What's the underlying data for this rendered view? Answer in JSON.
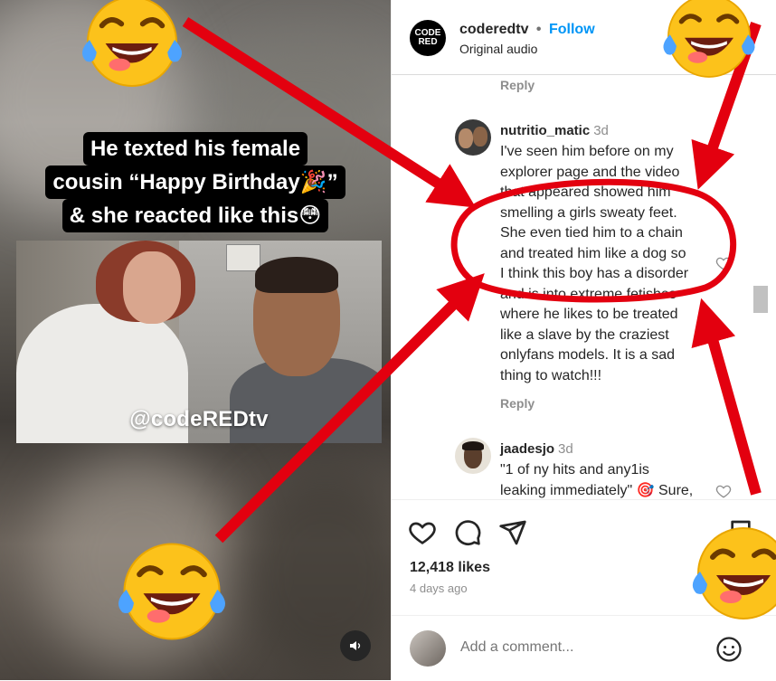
{
  "video": {
    "caption_lines": [
      "He texted his female",
      "cousin “Happy Birthday🎉”",
      "& she reacted like this😳"
    ],
    "watermark": "@codeREDtv",
    "mute_icon": "speaker-icon"
  },
  "post": {
    "logo_top": "CODE",
    "logo_bottom": "RED",
    "username": "coderedtv",
    "separator": "•",
    "follow_label": "Follow",
    "audio_label": "Original audio"
  },
  "comments": {
    "reply_label": "Reply",
    "items": [
      {
        "username": "nutritio_matic",
        "time": "3d",
        "lines": [
          "I've seen him before on my",
          "explorer page and the video",
          "that appeared showed him",
          "smelling a girls sweaty feet.",
          "She even tied him to a chain",
          "and treated him like a dog so",
          "I think this boy has a disorder",
          "and is into extreme fetishes",
          "where he likes to be treated",
          "like a slave by the craziest",
          "onlyfans models. It is a sad",
          "thing to watch!!!"
        ]
      },
      {
        "username": "jaadesjo",
        "time": "3d",
        "lines": [
          "\"1 of ny hits and any1is",
          "leaking immediately\" 🎯 Sure,"
        ]
      }
    ]
  },
  "actions": {
    "likes": "12,418 likes",
    "ago": "4 days ago"
  },
  "add_comment": {
    "placeholder": "Add a comment..."
  },
  "colors": {
    "accent": "#0095f6",
    "annotation_red": "#e3000f",
    "text_secondary": "#8e8e8e"
  }
}
